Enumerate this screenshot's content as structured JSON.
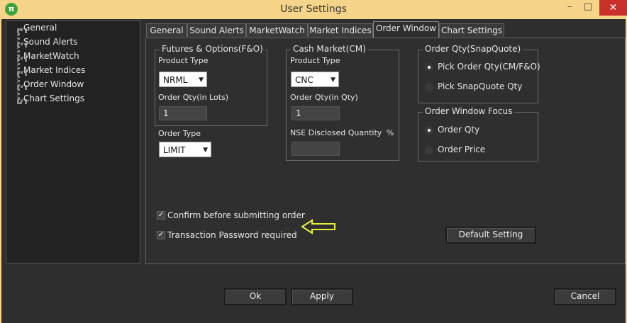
{
  "window": {
    "title": "User Settings",
    "app_icon": "pi-icon",
    "app_icon_glyph": "π",
    "minimize_glyph": "–",
    "maximize_glyph": "□",
    "close_glyph": "✕"
  },
  "sidebar": {
    "items": [
      {
        "label": "General"
      },
      {
        "label": "Sound Alerts"
      },
      {
        "label": "MarketWatch"
      },
      {
        "label": "Market Indices"
      },
      {
        "label": "Order Window"
      },
      {
        "label": "Chart Settings"
      }
    ]
  },
  "tabs": [
    {
      "label": "General"
    },
    {
      "label": "Sound Alerts"
    },
    {
      "label": "MarketWatch"
    },
    {
      "label": "Market Indices"
    },
    {
      "label": "Order Window",
      "active": true
    },
    {
      "label": "Chart Settings"
    }
  ],
  "fno": {
    "group_title": "Futures & Options(F&O)",
    "product_type_label": "Product Type",
    "product_type_value": "NRML",
    "order_qty_label": "Order Qty(in Lots)",
    "order_qty_value": "1",
    "order_type_label": "Order Type",
    "order_type_value": "LIMIT"
  },
  "cm": {
    "group_title": "Cash Market(CM)",
    "product_type_label": "Product Type",
    "product_type_value": "CNC",
    "order_qty_label": "Order Qty(in Qty)",
    "order_qty_value": "1",
    "disclosed_label": "NSE Disclosed Quantity",
    "disclosed_unit": "%",
    "disclosed_value": ""
  },
  "snapquote": {
    "group_title": "Order Qty(SnapQuote)",
    "options": [
      {
        "label": "Pick Order Qty(CM/F&O)",
        "selected": true
      },
      {
        "label": "Pick SnapQuote Qty",
        "selected": false
      }
    ]
  },
  "focus": {
    "group_title": "Order Window Focus",
    "options": [
      {
        "label": "Order Qty",
        "selected": true
      },
      {
        "label": "Order Price",
        "selected": false
      }
    ]
  },
  "checks": [
    {
      "label": "Confirm before submitting order",
      "checked": true
    },
    {
      "label": "Transaction Password required",
      "checked": true
    }
  ],
  "check_glyph": "✓",
  "buttons": {
    "default_setting": "Default Setting",
    "ok": "Ok",
    "apply": "Apply",
    "cancel": "Cancel"
  },
  "annotation_color": "#e8ef3a",
  "accent_titlebar": "#f6d48a"
}
